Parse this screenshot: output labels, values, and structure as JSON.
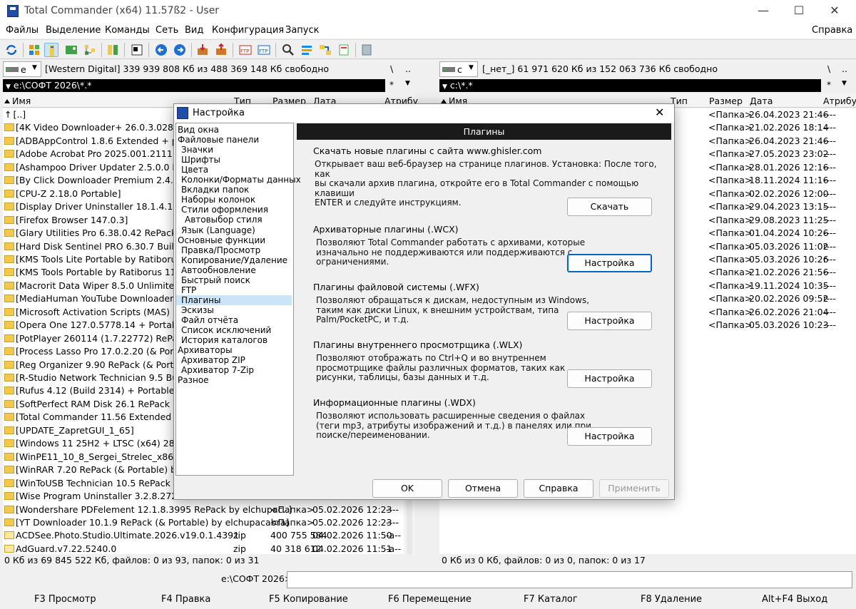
{
  "window": {
    "title": "Total Commander (x64) 11.57ß2 - User"
  },
  "menu": [
    "Файлы",
    "Выделение",
    "Команды",
    "Сеть",
    "Вид",
    "Конфигурация",
    "Запуск"
  ],
  "menu_help": "Справка",
  "left": {
    "drive": "e",
    "drive_info": "[Western Digital]  339 939 808 Кб из 488 369 148 Кб свободно",
    "root_btn": "\\",
    "up_btn": "..",
    "path": "e:\\СОФТ 2026\\*.*",
    "star": "*",
    "columns": {
      "name": "Имя",
      "type": "Тип",
      "size": "Размер",
      "date": "Дата",
      "attr": "Атрибу"
    },
    "rows": [
      {
        "name": "[..]",
        "type": "",
        "size": "",
        "date": "",
        "attr": "",
        "up": true
      },
      {
        "name": "[4K Video Downloader+ 26.0.3.0285 R",
        "type": "",
        "size": "",
        "date": "",
        "attr": ""
      },
      {
        "name": "[ADBAppControl 1.8.6 Extended + por",
        "type": "",
        "size": "",
        "date": "",
        "attr": ""
      },
      {
        "name": "[Adobe Acrobat Pro 2025.001.21111 R",
        "type": "",
        "size": "",
        "date": "",
        "attr": ""
      },
      {
        "name": "[Ashampoo Driver Updater 2.5.0.0 ReP",
        "type": "",
        "size": "",
        "date": "",
        "attr": ""
      },
      {
        "name": "[By Click Downloader Premium 2.4.28",
        "type": "",
        "size": "",
        "date": "",
        "attr": ""
      },
      {
        "name": "[CPU-Z 2.18.0 Portable]",
        "type": "",
        "size": "",
        "date": "",
        "attr": ""
      },
      {
        "name": "[Display Driver Uninstaller 18.1.4.1 + P",
        "type": "",
        "size": "",
        "date": "",
        "attr": ""
      },
      {
        "name": "[Firefox Browser 147.0.3]",
        "type": "",
        "size": "",
        "date": "",
        "attr": ""
      },
      {
        "name": "[Glary Utilities Pro 6.38.0.42 RePack (&",
        "type": "",
        "size": "",
        "date": "",
        "attr": ""
      },
      {
        "name": "[Hard Disk Sentinel PRO 6.30.7 Build 1",
        "type": "",
        "size": "",
        "date": "",
        "attr": ""
      },
      {
        "name": "[KMS Tools Lite Portable by Ratiborus",
        "type": "",
        "size": "",
        "date": "",
        "attr": ""
      },
      {
        "name": "[KMS Tools Portable by Ratiborus 11.0",
        "type": "",
        "size": "",
        "date": "",
        "attr": ""
      },
      {
        "name": "[Macrorit Data Wiper 8.5.0 Unlimited R",
        "type": "",
        "size": "",
        "date": "",
        "attr": ""
      },
      {
        "name": "[MediaHuman YouTube Downloader 3",
        "type": "",
        "size": "",
        "date": "",
        "attr": ""
      },
      {
        "name": "[Microsoft Activation Scripts (MAS) 3.1",
        "type": "",
        "size": "",
        "date": "",
        "attr": ""
      },
      {
        "name": "[Opera One 127.0.5778.14 + Portable]",
        "type": "",
        "size": "",
        "date": "",
        "attr": ""
      },
      {
        "name": "[PotPlayer 260114 (1.7.22772) RePack",
        "type": "",
        "size": "",
        "date": "",
        "attr": ""
      },
      {
        "name": "[Process Lasso Pro 17.0.2.20 (& Portab",
        "type": "",
        "size": "",
        "date": "",
        "attr": ""
      },
      {
        "name": "[Reg Organizer 9.90 RePack (& Portabl",
        "type": "",
        "size": "",
        "date": "",
        "attr": ""
      },
      {
        "name": "[R-Studio Network  Technician 9.5 Buil",
        "type": "",
        "size": "",
        "date": "",
        "attr": ""
      },
      {
        "name": "[Rufus 4.12 (Build 2314) + Portable]",
        "type": "",
        "size": "",
        "date": "",
        "attr": ""
      },
      {
        "name": "[SoftPerfect RAM Disk 26.1 RePack by",
        "type": "",
        "size": "",
        "date": "",
        "attr": ""
      },
      {
        "name": "[Total Commander 11.56 Extended 25.",
        "type": "",
        "size": "",
        "date": "",
        "attr": ""
      },
      {
        "name": "[UPDATE_ZapretGUI_1_65]",
        "type": "",
        "size": "",
        "date": "",
        "attr": ""
      },
      {
        "name": "[Windows 11 25H2 + LTSC (x64) 28in1",
        "type": "",
        "size": "",
        "date": "",
        "attr": ""
      },
      {
        "name": "[WinPE11_10_8_Sergei_Strelec_x86_x6",
        "type": "",
        "size": "",
        "date": "",
        "attr": ""
      },
      {
        "name": "[WinRAR 7.20 RePack (& Portable) by",
        "type": "",
        "size": "",
        "date": "",
        "attr": ""
      },
      {
        "name": "[WinToUSB Technician 10.5 RePack (&",
        "type": "",
        "size": "",
        "date": "",
        "attr": ""
      },
      {
        "name": "[Wise Program Uninstaller 3.2.8.272 Re",
        "type": "",
        "size": "",
        "date": "",
        "attr": ""
      },
      {
        "name": "[Wondershare PDFelement 12.1.8.3995 RePack by elchupac..]",
        "type": "",
        "size": "<Папка>",
        "date": "05.02.2026 12:23",
        "attr": "----"
      },
      {
        "name": "[YT Downloader 10.1.9 RePack (& Portable) by elchupacabra]",
        "type": "",
        "size": "<Папка>",
        "date": "05.02.2026 12:23",
        "attr": "----"
      },
      {
        "name": "ACDSee.Photo.Studio.Ultimate.2026.v19.0.1.4391",
        "type": "zip",
        "size": "400 755 584",
        "date": "04.02.2026 11:50",
        "attr": "-a--",
        "file": true
      },
      {
        "name": "AdGuard.v7.22.5240.0",
        "type": "zip",
        "size": "40 318 612",
        "date": "04.02.2026 11:51",
        "attr": "-a--",
        "file": true
      }
    ],
    "status": "0 Кб из 69 845 522 Кб, файлов: 0 из 93, папок: 0 из 31"
  },
  "right": {
    "drive": "c",
    "drive_info": "[_нет_]  61 971 620 Кб из 152 063 736 Кб свободно",
    "root_btn": "\\",
    "up_btn": "..",
    "path": "c:\\*.*",
    "star": "*",
    "columns": {
      "name": "Имя",
      "type": "Тип",
      "size": "Размер",
      "date": "Дата",
      "attr": "Атрибу"
    },
    "rows": [
      {
        "size": "<Папка>",
        "date": "26.04.2023 21:46",
        "attr": "----"
      },
      {
        "size": "<Папка>",
        "date": "21.02.2026 18:14",
        "attr": "----"
      },
      {
        "size": "<Папка>",
        "date": "26.04.2023 21:46",
        "attr": "----"
      },
      {
        "size": "<Папка>",
        "date": "27.05.2023 23:02",
        "attr": "----"
      },
      {
        "size": "<Папка>",
        "date": "28.01.2026 12:16",
        "attr": "----"
      },
      {
        "size": "<Папка>",
        "date": "18.11.2024 11:16",
        "attr": "----"
      },
      {
        "size": "<Папка>",
        "date": "02.02.2026 12:00",
        "attr": "----"
      },
      {
        "size": "<Папка>",
        "date": "29.04.2023 13:15",
        "attr": "----"
      },
      {
        "size": "<Папка>",
        "date": "29.08.2023 11:25",
        "attr": "----"
      },
      {
        "size": "<Папка>",
        "date": "01.04.2024 10:26",
        "attr": "----"
      },
      {
        "size": "<Папка>",
        "date": "05.03.2026 11:02",
        "attr": "r---"
      },
      {
        "size": "<Папка>",
        "date": "05.03.2026 10:26",
        "attr": "r---"
      },
      {
        "size": "<Папка>",
        "date": "21.02.2026 21:56",
        "attr": "----"
      },
      {
        "size": "<Папка>",
        "date": "19.11.2024 10:35",
        "attr": "----"
      },
      {
        "size": "<Папка>",
        "date": "20.02.2026 09:52",
        "attr": "r---"
      },
      {
        "size": "<Папка>",
        "date": "26.02.2026 21:04",
        "attr": "----"
      },
      {
        "size": "<Папка>",
        "date": "05.03.2026 10:23",
        "attr": "----"
      }
    ],
    "status": "0 Кб из 0 Кб, файлов: 0 из 0, папок: 0 из 17"
  },
  "cmdline": {
    "label": "e:\\СОФТ 2026>",
    "value": ""
  },
  "fkeys": [
    "F3 Просмотр",
    "F4 Правка",
    "F5 Копирование",
    "F6 Перемещение",
    "F7 Каталог",
    "F8 Удаление",
    "Alt+F4 Выход"
  ],
  "dialog": {
    "title": "Настройка",
    "tree": [
      {
        "label": "Вид окна",
        "indent": 0
      },
      {
        "label": "Файловые панели",
        "indent": 0
      },
      {
        "label": "Значки",
        "indent": 1
      },
      {
        "label": "Шрифты",
        "indent": 1
      },
      {
        "label": "Цвета",
        "indent": 1
      },
      {
        "label": "Колонки/Форматы данных",
        "indent": 1
      },
      {
        "label": "Вкладки папок",
        "indent": 1
      },
      {
        "label": "Наборы колонок",
        "indent": 1
      },
      {
        "label": "Стили оформления",
        "indent": 1
      },
      {
        "label": "Автовыбор стиля",
        "indent": 2
      },
      {
        "label": "Язык (Language)",
        "indent": 1
      },
      {
        "label": "Основные функции",
        "indent": 0
      },
      {
        "label": "Правка/Просмотр",
        "indent": 1
      },
      {
        "label": "Копирование/Удаление",
        "indent": 1
      },
      {
        "label": "Автообновление",
        "indent": 1
      },
      {
        "label": "Быстрый поиск",
        "indent": 1
      },
      {
        "label": "FTP",
        "indent": 1
      },
      {
        "label": "Плагины",
        "indent": 1,
        "selected": true
      },
      {
        "label": "Эскизы",
        "indent": 1
      },
      {
        "label": "Файл отчёта",
        "indent": 1
      },
      {
        "label": "Список исключений",
        "indent": 1
      },
      {
        "label": "История каталогов",
        "indent": 1
      },
      {
        "label": "Архиваторы",
        "indent": 0
      },
      {
        "label": "Архиватор ZIP",
        "indent": 1
      },
      {
        "label": "Архиватор 7-Zip",
        "indent": 1
      },
      {
        "label": "Разное",
        "indent": 0
      }
    ],
    "header": "Плагины",
    "download": {
      "heading": "Скачать новые плагины с сайта www.ghisler.com",
      "desc": [
        "Открывает ваш веб-браузер на странице плагинов. Установка: После того, как",
        "вы скачали архив плагина, откройте его в Total Commander с помощью клавиши",
        "ENTER и следуйте инструкциям."
      ],
      "button": "Скачать"
    },
    "sections": [
      {
        "heading": "Архиваторные плагины (.WCX)",
        "desc": [
          "Позволяют Total Commander работать с архивами, которые",
          "изначально не поддерживаются или поддерживаются с",
          "ограничениями."
        ],
        "button": "Настройка",
        "focus": true
      },
      {
        "heading": "Плагины файловой системы (.WFX)",
        "desc": [
          "Позволяют обращаться к дискам, недоступным из Windows,",
          "таким как диски Linux, к внешним устройствам, типа",
          "Palm/PocketPC, и т.д."
        ],
        "button": "Настройка"
      },
      {
        "heading": "Плагины внутреннего просмотрщика (.WLX)",
        "desc": [
          "Позволяют отображать по Ctrl+Q и во внутреннем",
          "просмотрщике файлы различных форматов, таких как",
          "рисунки, таблицы, базы данных и т.д."
        ],
        "button": "Настройка"
      },
      {
        "heading": "Информационные плагины (.WDX)",
        "desc": [
          "Позволяют использовать расширенные сведения о файлах",
          "(теги mp3, атрибуты изображений и т.д.) в панелях или при",
          "поиске/переименовании."
        ],
        "button": "Настройка"
      }
    ],
    "buttons": {
      "ok": "OK",
      "cancel": "Отмена",
      "help": "Справка",
      "apply": "Применить"
    }
  }
}
